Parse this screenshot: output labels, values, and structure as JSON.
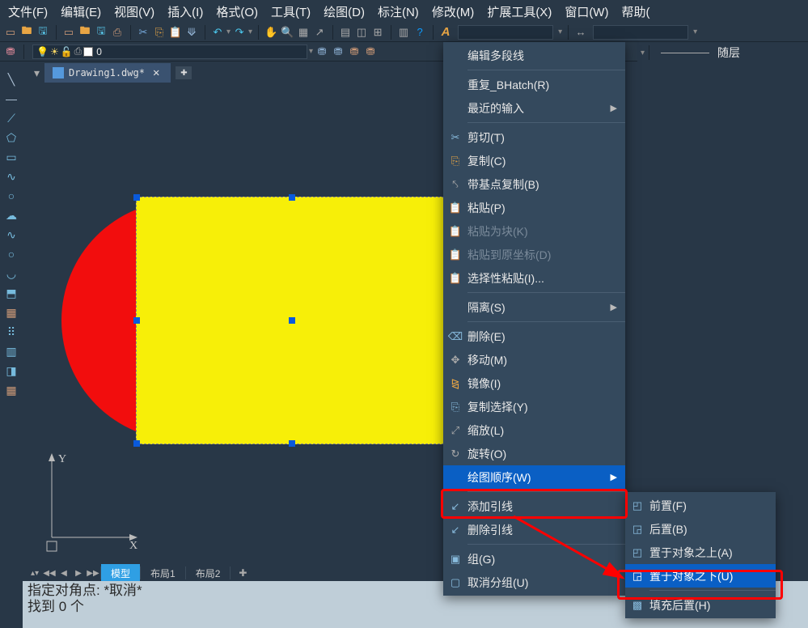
{
  "menubar": [
    "文件(F)",
    "编辑(E)",
    "视图(V)",
    "插入(I)",
    "格式(O)",
    "工具(T)",
    "绘图(D)",
    "标注(N)",
    "修改(M)",
    "扩展工具(X)",
    "窗口(W)",
    "帮助("
  ],
  "tab": {
    "filename": "Drawing1.dwg*"
  },
  "layer": {
    "name": "0"
  },
  "bylayer": "随层",
  "layout_tabs": {
    "model": "模型",
    "layout1": "布局1",
    "layout2": "布局2"
  },
  "ucs": {
    "x": "X",
    "y": "Y"
  },
  "cmd": {
    "l1": "指定对角点: *取消*",
    "l2": "找到 0 个"
  },
  "ctx": {
    "edit_pline": "编辑多段线",
    "repeat": "重复_BHatch(R)",
    "recent": "最近的输入",
    "cut": "剪切(T)",
    "copy": "复制(C)",
    "copyb": "带基点复制(B)",
    "paste": "粘贴(P)",
    "paste_block": "粘贴为块(K)",
    "paste_orig": "粘贴到原坐标(D)",
    "paste_sel": "选择性粘贴(I)...",
    "isolate": "隔离(S)",
    "delete": "删除(E)",
    "move": "移动(M)",
    "mirror": "镜像(I)",
    "copysel": "复制选择(Y)",
    "scale": "缩放(L)",
    "rotate": "旋转(O)",
    "draworder": "绘图顺序(W)",
    "addleader": "添加引线",
    "delleader": "删除引线",
    "group": "组(G)",
    "ungroup": "取消分组(U)"
  },
  "sub": {
    "front": "前置(F)",
    "back": "后置(B)",
    "above": "置于对象之上(A)",
    "below": "置于对象之下(U)",
    "hatchback": "填充后置(H)"
  }
}
